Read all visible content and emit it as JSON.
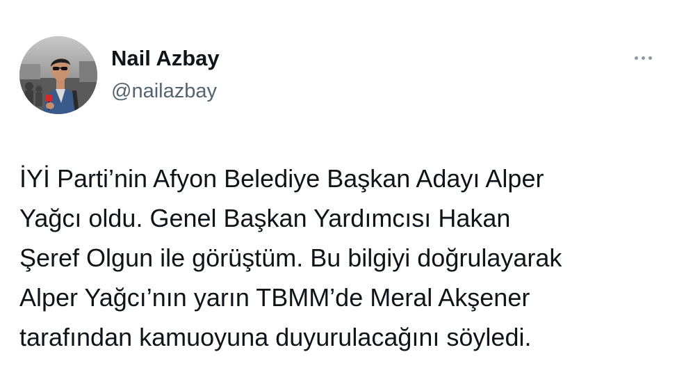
{
  "author": {
    "name": "Nail Azbay",
    "handle": "@nailazbay",
    "avatar_alt": "profile-photo"
  },
  "more_menu": {
    "icon": "more-horizontal-icon"
  },
  "tweet": {
    "lines": [
      "İYİ Parti’nin Afyon Belediye Başkan Adayı Alper",
      "Yağcı oldu. Genel Başkan Yardımcısı Hakan",
      "Şeref Olgun ile görüştüm. Bu bilgiyi doğrulayarak",
      "Alper Yağcı’nın yarın TBMM’de Meral Akşener",
      "tarafından kamuoyuna duyurulacağını söyledi."
    ]
  },
  "colors": {
    "text_primary": "#0f1419",
    "text_secondary": "#536471",
    "background": "#ffffff"
  }
}
